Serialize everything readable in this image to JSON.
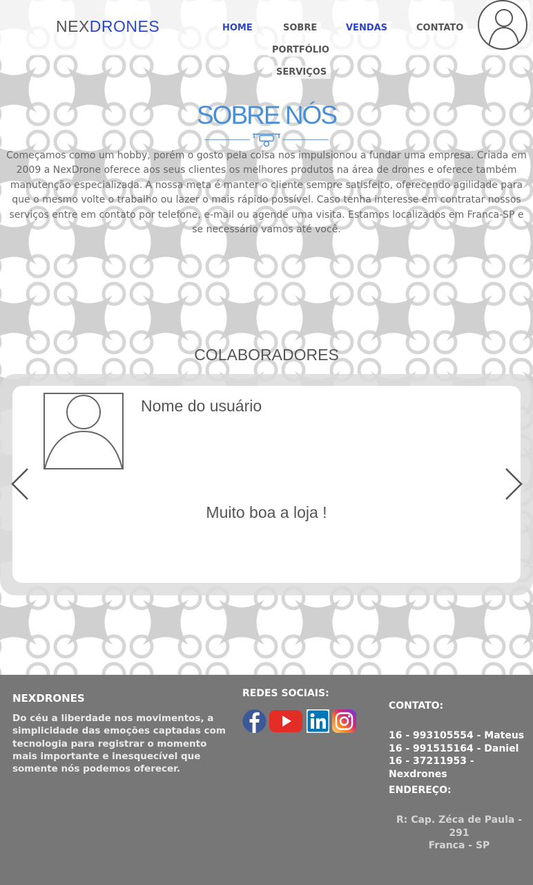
{
  "header": {
    "logo_part1": "NEX",
    "logo_part2": "DRONES",
    "nav": {
      "home": "HOME",
      "sobre": "SOBRE",
      "vendas": "VENDAS",
      "contato": "CONTATO",
      "portfolio": "PORTFÓLIO",
      "servicos": "SERVIÇOS"
    }
  },
  "about": {
    "title": "SOBRE NÓS",
    "text": "Começamos como um hobby, porém o gosto pela coisa nos impulsionou a fundar uma empresa. Criada em 2009 a NexDrone oferece aos seus clientes os melhores produtos na área de drones e oferece também manutenção especializada. A nossa meta é manter o cliente sempre satisfeito, oferecendo agilidade para que o mesmo volte o trabalho ou lazer o mais rápido possível. Caso tenha interesse em contratar nossos serviços entre em contato por telefone, e-mail ou agende uma visita. Estamos localizados em Franca-SP e se necessário vamos até você."
  },
  "collaborators": {
    "title": "COLABORADORES",
    "card": {
      "name": "Nome do usuário",
      "quote": "Muito boa a loja !"
    }
  },
  "footer": {
    "brand_title": "NEXDRONES",
    "brand_text": "Do céu a liberdade nos movimentos, a simplicidade das emoções captadas com tecnologia para registrar o momento mais importante e inesquecível que somente nós podemos oferecer.",
    "social_title": "REDES SOCIAIS:",
    "contact_title": "CONTATO:",
    "phones": [
      "16 - 993105554 - Mateus",
      "16 - 991515164 - Daniel",
      "16 - 37211953 - Nexdrones"
    ],
    "address_title": "ENDEREÇO:",
    "address_line1": "R: Cap. Zéca de Paula - 291",
    "address_line2": "Franca - SP"
  },
  "colors": {
    "brand_blue": "#2b47c7",
    "title_blue": "#4a90d9",
    "footer_bg": "#777777"
  }
}
